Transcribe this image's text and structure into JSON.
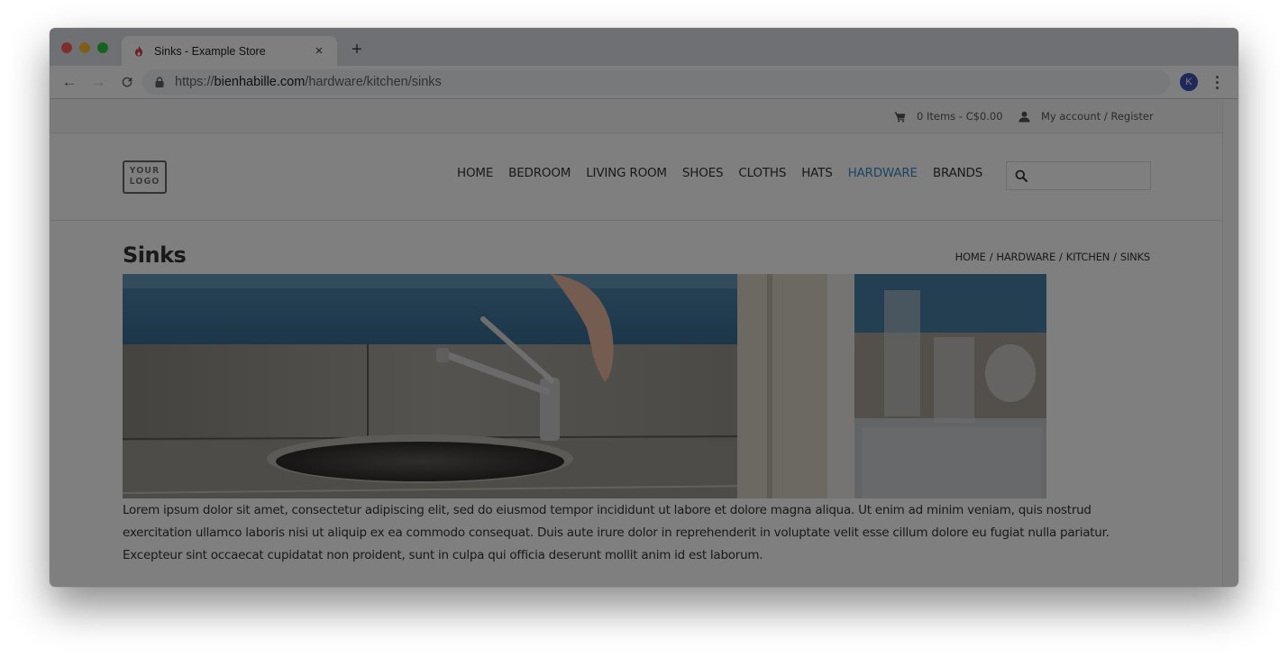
{
  "browser": {
    "tab": {
      "title": "Sinks - Example Store",
      "favicon": "flame-icon",
      "close_label": "×"
    },
    "new_tab_label": "+",
    "nav": {
      "back_icon": "←",
      "forward_icon": "→",
      "reload_icon": "C"
    },
    "url": {
      "scheme": "https://",
      "host": "bienhabille.com",
      "path": "/hardware/kitchen/sinks"
    },
    "profile_initial": "K",
    "colors": {
      "profile": "#3f51b5",
      "favicon": "#d9363e"
    }
  },
  "topbar": {
    "cart_icon": "shopping-cart-icon",
    "cart_text": "0 Items - C$0.00",
    "account_icon": "user-icon",
    "account_text": "My account / Register"
  },
  "header": {
    "logo_line1": "YOUR",
    "logo_line2": "LOGO",
    "nav": [
      {
        "label": "HOME",
        "active": false
      },
      {
        "label": "BEDROOM",
        "active": false
      },
      {
        "label": "LIVING ROOM",
        "active": false
      },
      {
        "label": "SHOES",
        "active": false
      },
      {
        "label": "CLOTHS",
        "active": false
      },
      {
        "label": "HATS",
        "active": false
      },
      {
        "label": "HARDWARE",
        "active": true
      },
      {
        "label": "BRANDS",
        "active": false
      }
    ],
    "search_placeholder": "",
    "active_color": "#3b88c3"
  },
  "content": {
    "title": "Sinks",
    "breadcrumb": [
      "HOME",
      "HARDWARE",
      "KITCHEN",
      "SINKS"
    ],
    "breadcrumb_separator": "/",
    "hero_image": "kitchen sink with faucet and glasses",
    "description": "Lorem ipsum dolor sit amet, consectetur adipiscing elit, sed do eiusmod tempor incididunt ut labore et dolore magna aliqua. Ut enim ad minim veniam, quis nostrud exercitation ullamco laboris nisi ut aliquip ex ea commodo consequat. Duis aute irure dolor in reprehenderit in voluptate velit esse cillum dolore eu fugiat nulla pariatur. Excepteur sint occaecat cupidatat non proident, sunt in culpa qui officia deserunt mollit anim id est laborum."
  }
}
